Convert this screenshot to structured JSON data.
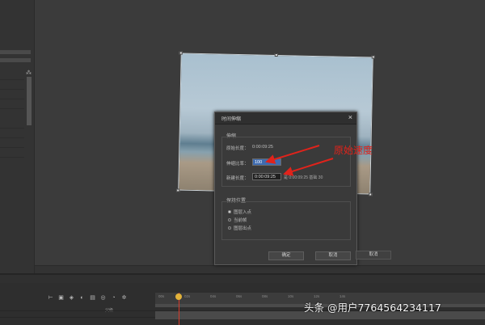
{
  "dialog": {
    "title": "时间伸缩",
    "close_glyph": "×",
    "stretch_group_label": "伸缩",
    "original_duration_label": "原始长度：",
    "original_duration_value": "0:00:09:25",
    "stretch_factor_label": "伸缩比率：",
    "stretch_factor_value": "100",
    "new_duration_label": "新建长度：",
    "new_duration_value": "0:00:09:25",
    "new_duration_note": "是 0:00:09:25 基础 30",
    "hold_group_label": "保持位置",
    "hold_options": [
      {
        "label": "图层入点",
        "selected": true
      },
      {
        "label": "当前帧",
        "selected": false
      },
      {
        "label": "图层出点",
        "selected": false
      }
    ],
    "ok_label": "确定",
    "cancel_label": "取消"
  },
  "ghost_button_label": "取消",
  "annotation": {
    "text": "原始速度",
    "color": "#e0231b"
  },
  "timeline": {
    "ruler_ticks": [
      "00s",
      "02s",
      "04s",
      "06s",
      "08s",
      "10s",
      "12s",
      "14s"
    ],
    "column_header": "父级",
    "playhead_color": "#d63a2a"
  },
  "watermark": "头条 @用户7764564234117"
}
